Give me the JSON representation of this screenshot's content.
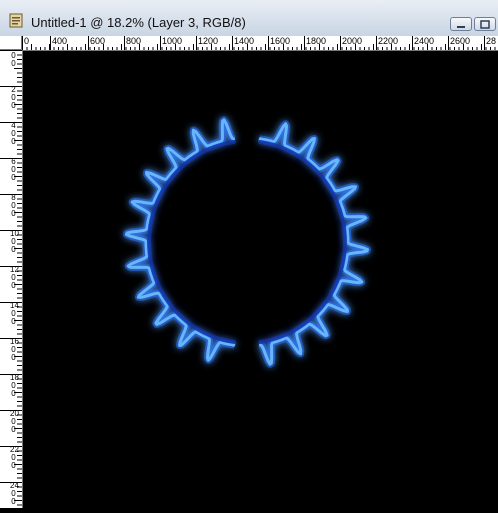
{
  "window": {
    "title": "Untitled-1 @ 18.2% (Layer 3, RGB/8)",
    "icon": "photoshop-document-icon"
  },
  "rulers": {
    "horizontal_labels": [
      "0",
      "400",
      "600",
      "800",
      "1000",
      "1200",
      "1400",
      "1600",
      "1800",
      "2000",
      "2200",
      "2400",
      "2600",
      "28"
    ],
    "vertical_labels": [
      "0",
      "2",
      "4",
      "6",
      "8",
      "10",
      "12",
      "14",
      "16",
      "18",
      "20",
      "22",
      "24",
      "26"
    ]
  },
  "canvas": {
    "background": "#000000",
    "content": "gas-burner-flame-ring",
    "flame_color": "#1e6bff"
  }
}
